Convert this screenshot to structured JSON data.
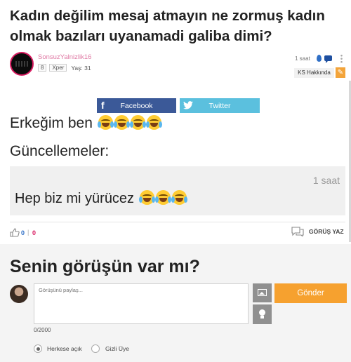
{
  "question": {
    "title": "Kadın değilim mesaj atmayın ne zormuş kadın olmak bazıları uyanamadi galiba dimi?"
  },
  "author": {
    "username": "SonsuzYalnizlik16",
    "level": "8",
    "badge": "Xper",
    "age": "Yaş: 31"
  },
  "post_meta": {
    "time": "1 saat",
    "ks_label": "KS Hakkında"
  },
  "share": {
    "facebook_label": "Facebook",
    "twitter_label": "Twitter",
    "facebook_color": "#3b5998",
    "twitter_color": "#5bc0de"
  },
  "content": {
    "body": "Erkeğim ben",
    "body_emojis": [
      "face-with-tears-of-joy",
      "face-with-tears-of-joy",
      "face-with-tears-of-joy",
      "face-with-tears-of-joy"
    ]
  },
  "updates": {
    "heading": "Güncellemeler:",
    "items": [
      {
        "time": "1 saat",
        "text": "Hep biz mi yürücez",
        "emojis": [
          "face-with-tears-of-joy",
          "face-with-tears-of-joy",
          "face-with-tears-of-joy"
        ]
      }
    ]
  },
  "reactions": {
    "likes": "0",
    "separator": "|",
    "dislikes": "0",
    "comment_label": "GÖRÜŞ YAZ"
  },
  "opinion_form": {
    "heading": "Senin görüşün var mı?",
    "placeholder": "Görüşünü paylaş...",
    "char_count": "0/2000",
    "send_label": "Gönder",
    "send_color": "#f6a12f",
    "visibility_options": [
      {
        "label": "Herkese açık",
        "checked": true
      },
      {
        "label": "Gizli Üye",
        "checked": false
      }
    ]
  }
}
